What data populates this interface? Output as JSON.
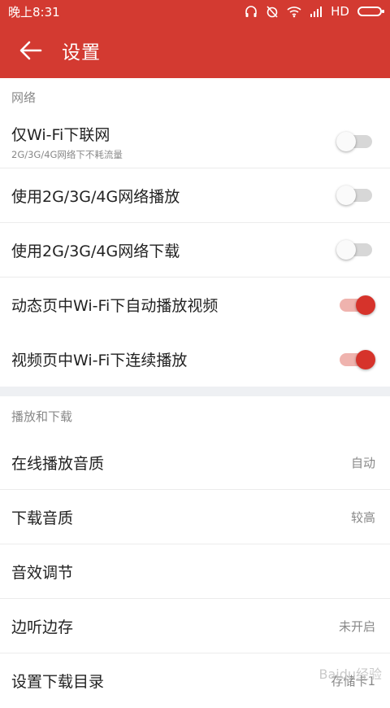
{
  "statusbar": {
    "time": "晚上8:31",
    "network": "HD"
  },
  "header": {
    "title": "设置"
  },
  "sections": [
    {
      "title": "网络",
      "rows": [
        {
          "label": "仅Wi-Fi下联网",
          "sub": "2G/3G/4G网络下不耗流量",
          "toggle": false
        },
        {
          "label": "使用2G/3G/4G网络播放",
          "toggle": false
        },
        {
          "label": "使用2G/3G/4G网络下载",
          "toggle": false
        },
        {
          "label": "动态页中Wi-Fi下自动播放视频",
          "toggle": true
        },
        {
          "label": "视频页中Wi-Fi下连续播放",
          "toggle": true
        }
      ]
    },
    {
      "title": "播放和下载",
      "rows": [
        {
          "label": "在线播放音质",
          "value": "自动"
        },
        {
          "label": "下载音质",
          "value": "较高"
        },
        {
          "label": "音效调节",
          "value": ""
        },
        {
          "label": "边听边存",
          "value": "未开启"
        },
        {
          "label": "设置下载目录",
          "value": "存储卡1"
        }
      ]
    }
  ],
  "colors": {
    "primary": "#d33a31",
    "toggle_on": "#d6332b"
  },
  "watermark": "Baidu经验"
}
